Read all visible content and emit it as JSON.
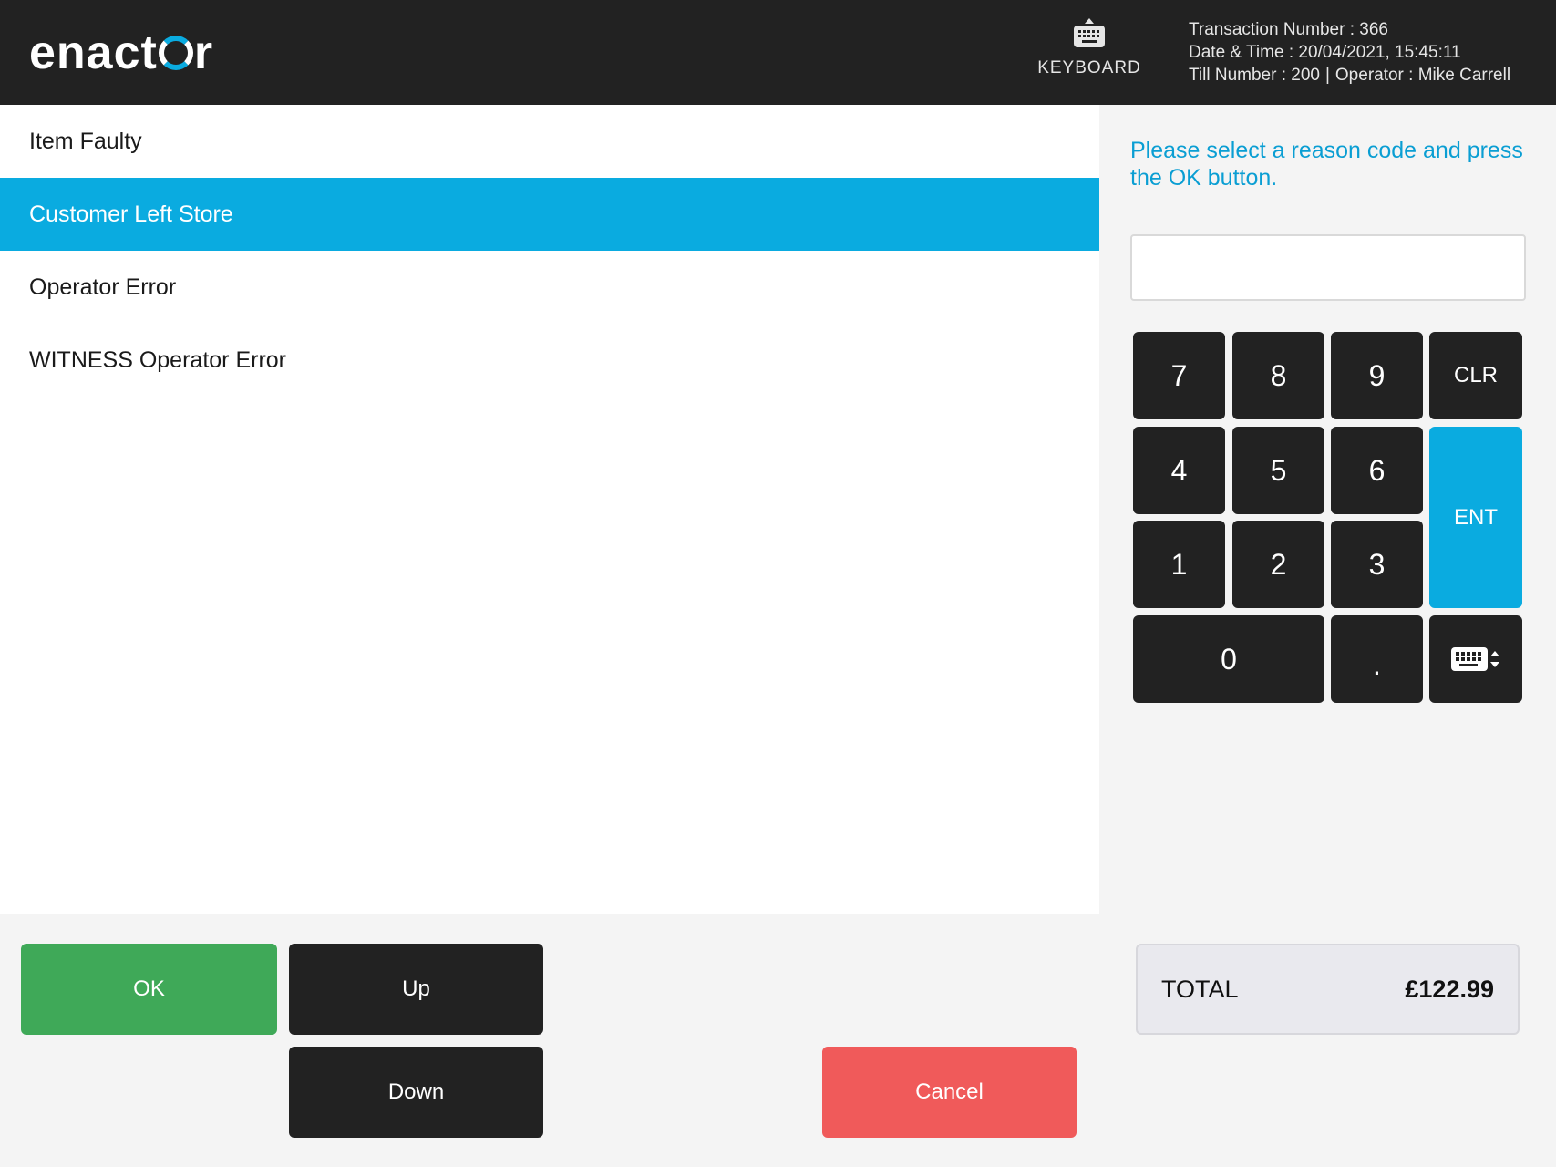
{
  "header": {
    "logo_text_left": "enact",
    "logo_text_right": "r",
    "keyboard_label": "KEYBOARD",
    "transaction_number_label": "Transaction Number : 366",
    "date_time_label": "Date & Time : 20/04/2021, 15:45:11",
    "till_label": "Till Number : 200",
    "separator": "|",
    "operator_label": "Operator : Mike Carrell"
  },
  "reasons": {
    "items": [
      {
        "label": "Item Faulty",
        "selected": false
      },
      {
        "label": "Customer Left Store",
        "selected": true
      },
      {
        "label": "Operator Error",
        "selected": false
      },
      {
        "label": "WITNESS Operator Error",
        "selected": false
      }
    ]
  },
  "prompt": {
    "text": "Please select a reason code and press the OK button."
  },
  "entry": {
    "value": "",
    "placeholder": ""
  },
  "keypad": {
    "k7": "7",
    "k8": "8",
    "k9": "9",
    "clr": "CLR",
    "k4": "4",
    "k5": "5",
    "k6": "6",
    "ent": "ENT",
    "k1": "1",
    "k2": "2",
    "k3": "3",
    "k0": "0",
    "dot": ".",
    "toggle_icon": "keyboard-toggle-icon"
  },
  "actions": {
    "ok": "OK",
    "up": "Up",
    "down": "Down",
    "cancel": "Cancel"
  },
  "total": {
    "label": "TOTAL",
    "amount": "£122.99"
  },
  "colors": {
    "header_bg": "#222222",
    "accent": "#0aabe0",
    "ok_green": "#3fa958",
    "cancel_red": "#f05a5a",
    "key_dark": "#222222"
  }
}
